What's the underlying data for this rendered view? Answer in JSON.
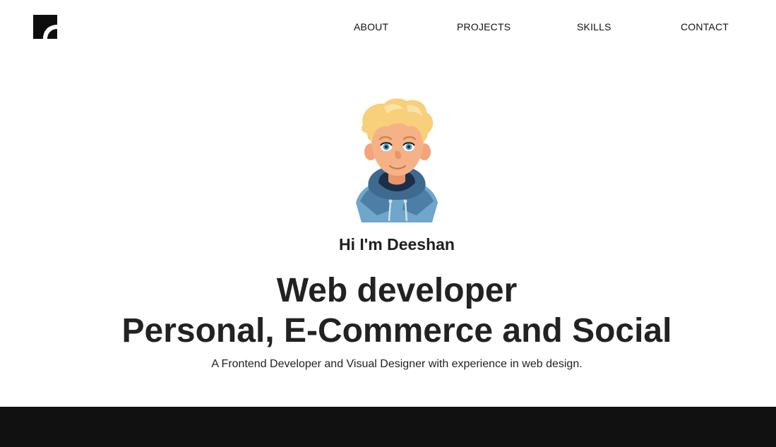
{
  "nav": {
    "about": "ABOUT",
    "projects": "PROJECTS",
    "skills": "SKILLS",
    "contact": "CONTACT"
  },
  "hero": {
    "greeting": "Hi I'm Deeshan",
    "headline_line1": "Web developer",
    "headline_line2": "Personal, E-Commerce and Social",
    "subtitle": "A Frontend Developer and Visual Designer with experience in web design."
  },
  "icons": {
    "logo": "brand-logo-icon",
    "avatar": "cartoon-avatar-illustration"
  },
  "colors": {
    "background": "#ffffff",
    "text": "#1c1c1c",
    "footer_band": "#111111"
  }
}
